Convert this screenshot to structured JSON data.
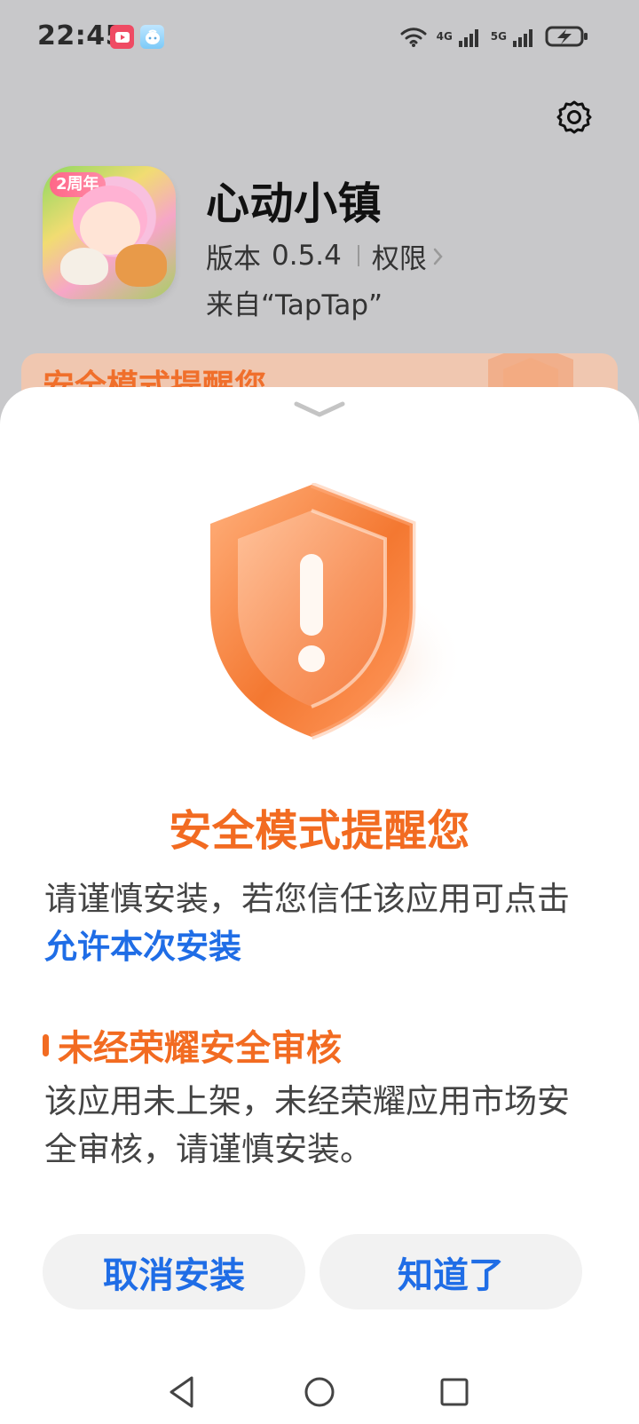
{
  "status_bar": {
    "time": "22:45",
    "app_icons": [
      "play-app-icon",
      "face-app-icon"
    ],
    "network_labels": [
      "4G",
      "5G"
    ],
    "icons": [
      "wifi-icon",
      "signal-4g-icon",
      "signal-5g-icon",
      "charging-battery-icon"
    ]
  },
  "header": {
    "settings_icon": "gear-icon",
    "app_icon_badge": "2周年",
    "app_name": "心动小镇",
    "version_label": "版本",
    "version_value": "0.5.4",
    "permissions_label": "权限",
    "source_text": "来自“TapTap”",
    "banner_title": "安全模式提醒您"
  },
  "dialog": {
    "handle_icon": "chevron-down-icon",
    "illustration_icon": "warning-shield-icon",
    "title": "安全模式提醒您",
    "message_prefix": "请谨慎安装，若您信任该应用可点击",
    "allow_link": "允许本次安装",
    "section_title": "未经荣耀安全审核",
    "section_description": "该应用未上架，未经荣耀应用市场安全审核，请谨慎安装。",
    "cancel_button": "取消安装",
    "ok_button": "知道了"
  },
  "colors": {
    "backdrop": "#c8c8ca",
    "sheet": "#ffffff",
    "orange": "#f26b21",
    "blue": "#1f6de6",
    "button_bg": "#f2f2f2",
    "body_text": "#444444"
  },
  "navigation": {
    "icons": [
      "back-icon",
      "home-icon",
      "recent-apps-icon"
    ]
  }
}
